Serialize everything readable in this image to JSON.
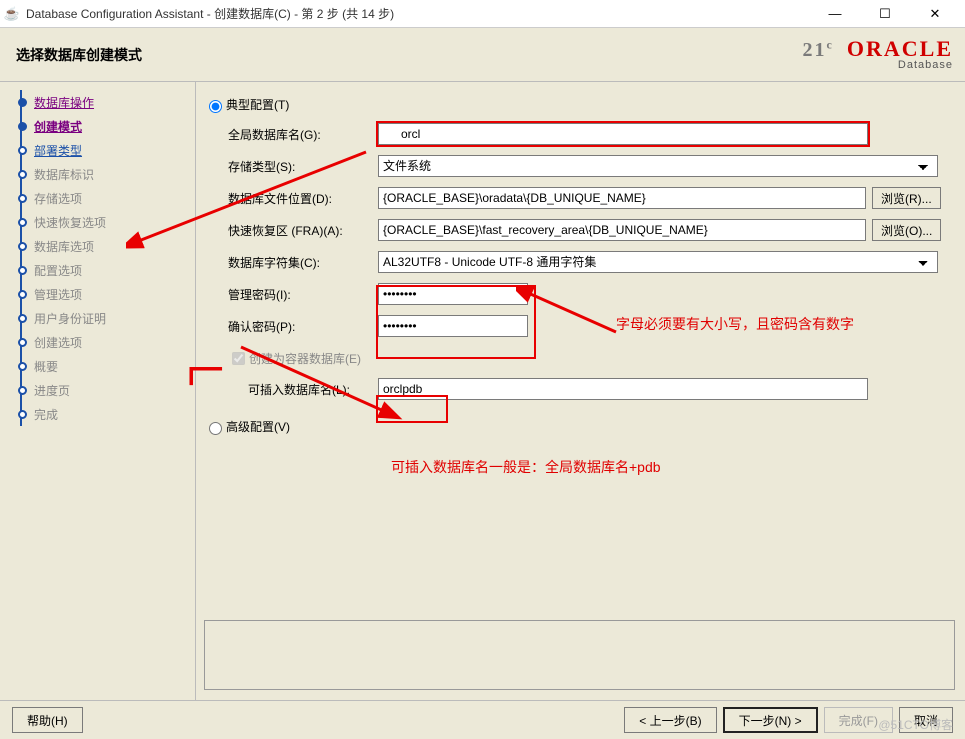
{
  "titlebar": {
    "title": "Database Configuration Assistant - 创建数据库(C) - 第 2 步 (共 14 步)"
  },
  "header": {
    "page_title": "选择数据库创建模式",
    "logo_ver": "21",
    "logo_c": "c",
    "logo_brand": "ORACLE",
    "logo_sub": "Database"
  },
  "sidebar": {
    "steps": [
      {
        "label": "数据库操作",
        "state": "done"
      },
      {
        "label": "创建模式",
        "state": "current"
      },
      {
        "label": "部署类型",
        "state": "pending-link"
      },
      {
        "label": "数据库标识",
        "state": "pending"
      },
      {
        "label": "存储选项",
        "state": "pending"
      },
      {
        "label": "快速恢复选项",
        "state": "pending"
      },
      {
        "label": "数据库选项",
        "state": "pending"
      },
      {
        "label": "配置选项",
        "state": "pending"
      },
      {
        "label": "管理选项",
        "state": "pending"
      },
      {
        "label": "用户身份证明",
        "state": "pending"
      },
      {
        "label": "创建选项",
        "state": "pending"
      },
      {
        "label": "概要",
        "state": "pending"
      },
      {
        "label": "进度页",
        "state": "pending"
      },
      {
        "label": "完成",
        "state": "pending"
      }
    ]
  },
  "form": {
    "typical_label": "典型配置(T)",
    "advanced_label": "高级配置(V)",
    "global_db_label": "全局数据库名(G):",
    "global_db_value": "orcl",
    "storage_label": "存储类型(S):",
    "storage_value": "文件系统",
    "dbfile_label": "数据库文件位置(D):",
    "dbfile_value": "{ORACLE_BASE}\\oradata\\{DB_UNIQUE_NAME}",
    "fra_label": "快速恢复区 (FRA)(A):",
    "fra_value": "{ORACLE_BASE}\\fast_recovery_area\\{DB_UNIQUE_NAME}",
    "charset_label": "数据库字符集(C):",
    "charset_value": "AL32UTF8 - Unicode UTF-8 通用字符集",
    "admin_pwd_label": "管理密码(I):",
    "admin_pwd_value": "••••••••",
    "confirm_pwd_label": "确认密码(P):",
    "confirm_pwd_value": "••••••••",
    "container_label": "创建为容器数据库(E)",
    "pdb_label": "可插入数据库名(L):",
    "pdb_value": "orclpdb",
    "browse_r": "浏览(R)...",
    "browse_o": "浏览(O)..."
  },
  "annotations": {
    "pwd_note": "字母必须要有大小写，且密码含有数字",
    "pdb_note": "可插入数据库名一般是：全局数据库名+pdb"
  },
  "footer": {
    "help": "帮助(H)",
    "back": "< 上一步(B)",
    "next": "下一步(N) >",
    "finish": "完成(F)",
    "cancel": "取消"
  },
  "watermark": "@51CTO博客"
}
